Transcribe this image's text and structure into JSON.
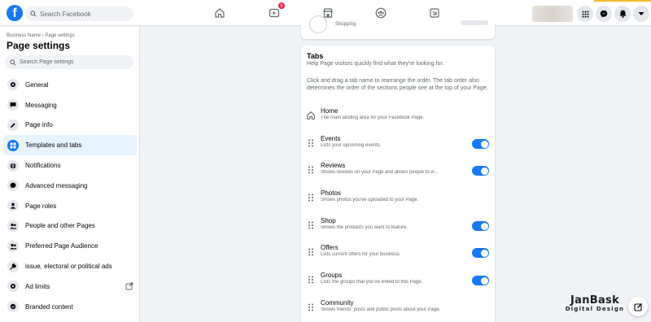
{
  "header": {
    "search_placeholder": "Search Facebook",
    "video_badge": "9",
    "brand_color": "#1877f2"
  },
  "sidebar": {
    "breadcrumb": "Business Name › Page settings",
    "title": "Page settings",
    "search_placeholder": "Search Page settings",
    "items": [
      {
        "label": "General",
        "icon": "gear-icon"
      },
      {
        "label": "Messaging",
        "icon": "chat-icon"
      },
      {
        "label": "Page info",
        "icon": "pencil-icon"
      },
      {
        "label": "Templates and tabs",
        "icon": "grid-icon",
        "active": true
      },
      {
        "label": "Notifications",
        "icon": "globe-icon"
      },
      {
        "label": "Advanced messaging",
        "icon": "messenger-icon"
      },
      {
        "label": "Page roles",
        "icon": "person-icon"
      },
      {
        "label": "People and other Pages",
        "icon": "people-icon"
      },
      {
        "label": "Preferred Page Audience",
        "icon": "people-icon"
      },
      {
        "label": "issue, electoral or political ads",
        "icon": "wrench-icon"
      },
      {
        "label": "Ad limits",
        "icon": "gear-icon"
      },
      {
        "label": "Branded content",
        "icon": "badge-icon"
      }
    ]
  },
  "main": {
    "top_card_text": "Shopping",
    "tabs_title": "Tabs",
    "tabs_subtitle": "Help Page visitors quickly find what they're looking for.",
    "tabs_instructions": "Click and drag a tab name to rearrange the order. The tab order also determines the order of the sections people see at the top of your Page.",
    "tabs": [
      {
        "name": "Home",
        "desc": "The main landing area for your Facebook Page.",
        "home": true,
        "toggle": false
      },
      {
        "name": "Events",
        "desc": "Lists your upcoming events.",
        "toggle": true
      },
      {
        "name": "Reviews",
        "desc": "Shows reviews on your Page and allows people to w...",
        "toggle": true
      },
      {
        "name": "Photos",
        "desc": "Shows photos you've uploaded to your Page.",
        "toggle": false
      },
      {
        "name": "Shop",
        "desc": "Shows the products you want to feature.",
        "toggle": true
      },
      {
        "name": "Offers",
        "desc": "Lists current offers for your business.",
        "toggle": true
      },
      {
        "name": "Groups",
        "desc": "Lists the groups that you've linked to this Page.",
        "toggle": true
      },
      {
        "name": "Community",
        "desc": "Shows friends' posts and public posts about your Page.",
        "toggle": false
      }
    ]
  },
  "watermark": {
    "line1": "JanBask",
    "line2": "Digital Design"
  }
}
